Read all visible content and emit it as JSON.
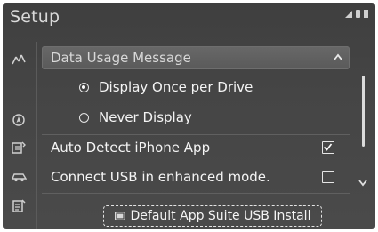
{
  "header": {
    "title": "Setup"
  },
  "sidebar": {
    "items": [
      {
        "icon": "signal-settings-icon"
      },
      {
        "icon": "navigation-icon"
      },
      {
        "icon": "phone-settings-icon"
      },
      {
        "icon": "vehicle-icon"
      },
      {
        "icon": "notes-icon"
      }
    ]
  },
  "list": {
    "section_header": "Data Usage Message",
    "radio_options": [
      {
        "label": "Display Once per Drive",
        "selected": true
      },
      {
        "label": "Never Display",
        "selected": false
      }
    ],
    "auto_detect": {
      "label": "Auto Detect iPhone App",
      "checked": true
    },
    "connect_usb": {
      "label": "Connect USB in enhanced mode.",
      "checked": false
    }
  },
  "footer": {
    "default_button_label": "Default App Suite USB Install"
  },
  "colors": {
    "background": "#444444",
    "text": "#f2f2f2",
    "header_bar": "#606060"
  }
}
